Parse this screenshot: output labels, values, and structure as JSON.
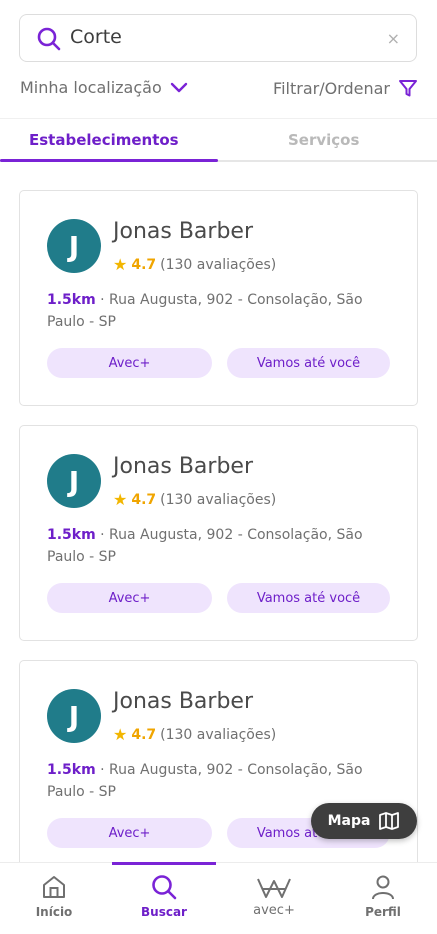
{
  "search": {
    "query": "Corte",
    "clear": "×"
  },
  "filters": {
    "location": "Minha localização",
    "filter": "Filtrar/Ordenar"
  },
  "tabs": [
    {
      "label": "Estabelecimentos",
      "active": true
    },
    {
      "label": "Serviços",
      "active": false
    }
  ],
  "cards": [
    {
      "initial": "J",
      "name": "Jonas Barber",
      "rating": "4.7",
      "reviews": "(130 avaliações)",
      "distance": "1.5km",
      "address": " · Rua Augusta, 902 - Consolação, São Paulo - SP",
      "pill_a": "Avec+",
      "pill_b": "Vamos até você"
    },
    {
      "initial": "J",
      "name": "Jonas Barber",
      "rating": "4.7",
      "reviews": "(130 avaliações)",
      "distance": "1.5km",
      "address": " · Rua Augusta, 902 - Consolação, São Paulo - SP",
      "pill_a": "Avec+",
      "pill_b": "Vamos até você"
    },
    {
      "initial": "J",
      "name": "Jonas Barber",
      "rating": "4.7",
      "reviews": "(130 avaliações)",
      "distance": "1.5km",
      "address": " · Rua Augusta, 902 - Consolação, São Paulo - SP",
      "pill_a": "Avec+",
      "pill_b": "Vamos até você"
    }
  ],
  "map_button": {
    "label": "Mapa"
  },
  "nav": [
    {
      "label": "Início",
      "icon": "home-icon"
    },
    {
      "label": "Buscar",
      "icon": "search-icon",
      "active": true
    },
    {
      "label": "avec+",
      "icon": "avec-logo-icon"
    },
    {
      "label": "Perfil",
      "icon": "user-icon"
    }
  ],
  "colors": {
    "accent": "#6e1fc9",
    "pill_bg": "#efe4fd",
    "avatar": "#207c8a",
    "star": "#f2b600"
  }
}
